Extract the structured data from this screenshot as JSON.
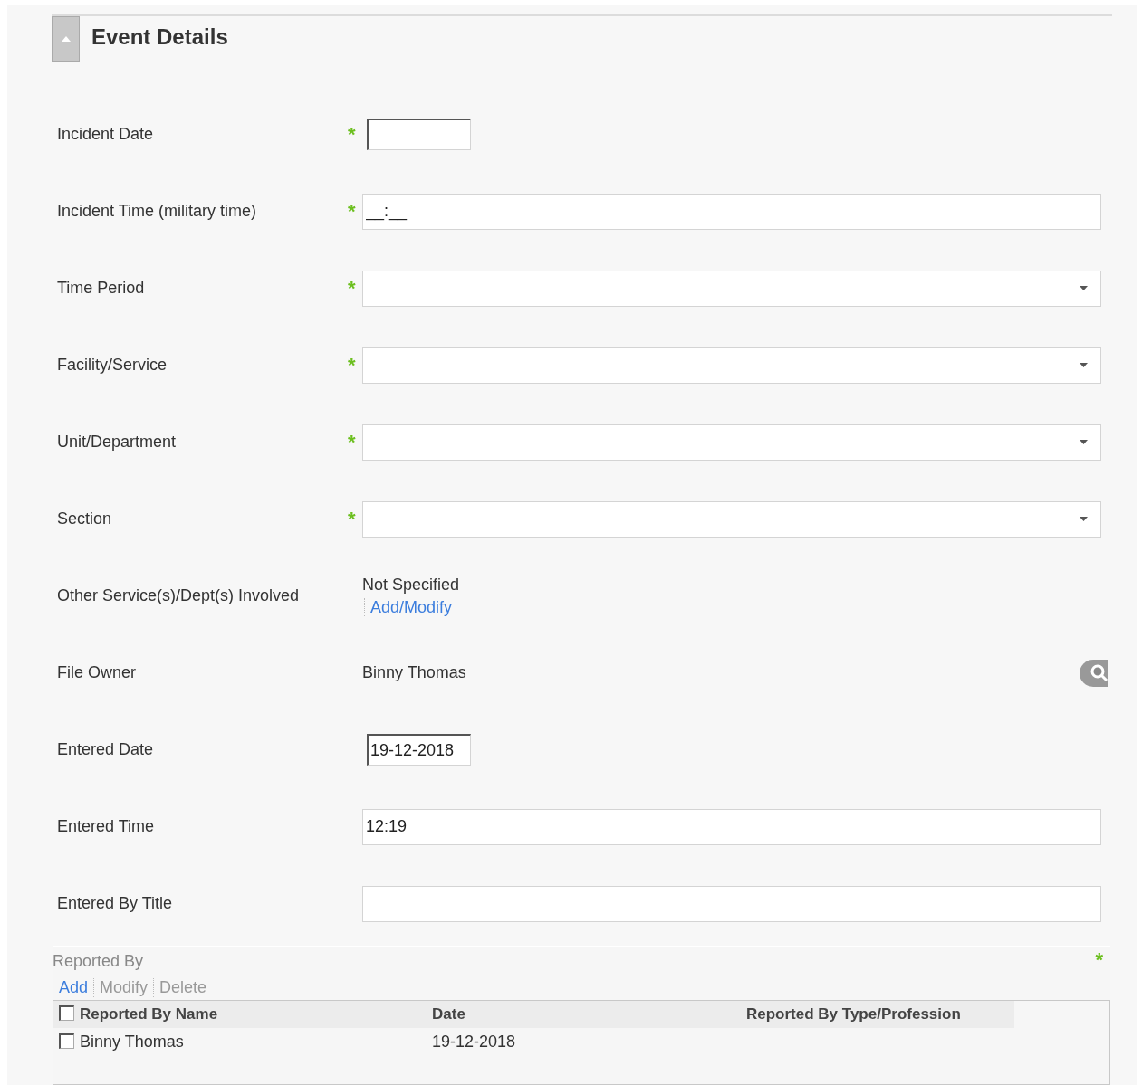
{
  "section": {
    "title": "Event Details",
    "expanded": true
  },
  "fields": [
    {
      "kind": "date",
      "label": "Incident Date",
      "required_mark": "*"
    },
    {
      "kind": "text",
      "label": "Incident Time (military time)",
      "required_mark": "*",
      "value": "__:__"
    },
    {
      "kind": "select",
      "label": "Time Period",
      "required_mark": "*"
    },
    {
      "kind": "select",
      "label": "Facility/Service",
      "required_mark": "*"
    },
    {
      "kind": "select",
      "label": "Unit/Department",
      "required_mark": "*"
    },
    {
      "kind": "select",
      "label": "Section",
      "required_mark": "*"
    },
    {
      "kind": "links",
      "label": "Other Service(s)/Dept(s) Involved",
      "value": "Not Specified",
      "link": "Add/Modify"
    },
    {
      "kind": "lookup",
      "label": "File Owner",
      "value": "Binny Thomas"
    },
    {
      "kind": "date",
      "label": "Entered Date",
      "value": "19-12-2018"
    },
    {
      "kind": "text",
      "label": "Entered Time",
      "value": "12:19"
    },
    {
      "kind": "text",
      "label": "Entered By Title"
    }
  ],
  "reported_by": {
    "title": "Reported By",
    "required_mark": "*",
    "actions": [
      {
        "label": "Add",
        "disabled": false
      },
      {
        "label": "Modify",
        "disabled": true
      },
      {
        "label": "Delete",
        "disabled": true
      }
    ],
    "table": {
      "select_all": {
        "checked": false
      },
      "columns": [
        "Reported By Name",
        "Date",
        "Reported By Type/Profession"
      ],
      "rows": [
        {
          "checked": false,
          "cells": [
            "Binny Thomas",
            "19-12-2018"
          ]
        }
      ]
    }
  }
}
